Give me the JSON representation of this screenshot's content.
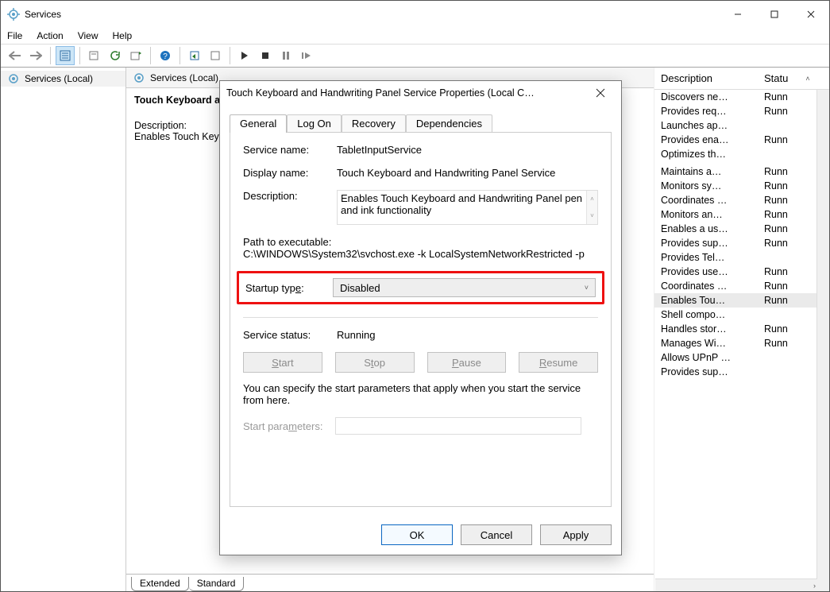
{
  "window": {
    "title": "Services"
  },
  "menubar": [
    "File",
    "Action",
    "View",
    "Help"
  ],
  "left_tree": {
    "item": "Services (Local)"
  },
  "center": {
    "header": "Services (Local)",
    "service_name": "Touch Keyboard and Handwriting Panel Service",
    "description_label": "Description:",
    "description_text": "Enables Touch Keyboard and Handwriting Panel pen and ink functionality"
  },
  "center_tabs": {
    "extended": "Extended",
    "standard": "Standard"
  },
  "right_list": {
    "columns": {
      "description": "Description",
      "status": "Statu"
    },
    "rows": [
      {
        "desc": "Discovers ne…",
        "status": "Runn"
      },
      {
        "desc": "Provides req…",
        "status": "Runn"
      },
      {
        "desc": "Launches ap…",
        "status": ""
      },
      {
        "desc": "Provides ena…",
        "status": "Runn"
      },
      {
        "desc": "Optimizes th…",
        "status": ""
      },
      {
        "desc": "",
        "status": ""
      },
      {
        "desc": "Maintains a…",
        "status": "Runn"
      },
      {
        "desc": "Monitors sy…",
        "status": "Runn"
      },
      {
        "desc": "Coordinates …",
        "status": "Runn"
      },
      {
        "desc": "Monitors an…",
        "status": "Runn"
      },
      {
        "desc": "Enables a us…",
        "status": "Runn"
      },
      {
        "desc": "Provides sup…",
        "status": "Runn"
      },
      {
        "desc": "Provides Tel…",
        "status": ""
      },
      {
        "desc": "Provides use…",
        "status": "Runn"
      },
      {
        "desc": "Coordinates …",
        "status": "Runn"
      },
      {
        "desc": "Enables Tou…",
        "status": "Runn",
        "highlighted": true
      },
      {
        "desc": "Shell compo…",
        "status": ""
      },
      {
        "desc": "Handles stor…",
        "status": "Runn"
      },
      {
        "desc": "Manages Wi…",
        "status": "Runn"
      },
      {
        "desc": "Allows UPnP …",
        "status": ""
      },
      {
        "desc": "Provides sup…",
        "status": ""
      }
    ]
  },
  "dialog": {
    "title": "Touch Keyboard and Handwriting Panel Service Properties (Local C…",
    "tabs": {
      "general": "General",
      "log_on": "Log On",
      "recovery": "Recovery",
      "dependencies": "Dependencies"
    },
    "service_name_label": "Service name:",
    "service_name_value": "TabletInputService",
    "display_name_label": "Display name:",
    "display_name_value": "Touch Keyboard and Handwriting Panel Service",
    "description_label": "Description:",
    "description_value": "Enables Touch Keyboard and Handwriting Panel pen and ink functionality",
    "path_label": "Path to executable:",
    "path_value": "C:\\WINDOWS\\System32\\svchost.exe -k LocalSystemNetworkRestricted -p",
    "startup_type_label": "Startup type:",
    "startup_type_value": "Disabled",
    "service_status_label": "Service status:",
    "service_status_value": "Running",
    "buttons": {
      "start": "Start",
      "stop": "Stop",
      "pause": "Pause",
      "resume": "Resume"
    },
    "hint": "You can specify the start parameters that apply when you start the service from here.",
    "start_parameters_label": "Start parameters:",
    "footer": {
      "ok": "OK",
      "cancel": "Cancel",
      "apply": "Apply"
    }
  }
}
